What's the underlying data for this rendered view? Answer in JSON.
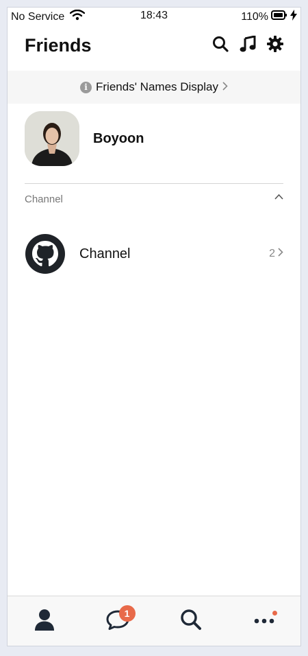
{
  "status_bar": {
    "carrier": "No Service",
    "time": "18:43",
    "battery": "110%"
  },
  "header": {
    "title": "Friends"
  },
  "banner": {
    "text": "Friends' Names Display"
  },
  "profile": {
    "name": "Boyoon"
  },
  "section": {
    "label": "Channel"
  },
  "channel": {
    "label": "Channel",
    "count": "2"
  },
  "tabbar": {
    "chat_badge": "1"
  },
  "colors": {
    "badge": "#e86a4a",
    "banner_bg": "#f6f6f6",
    "page_bg": "#e8ebf3"
  },
  "icons": [
    "wifi-icon",
    "battery-icon",
    "charging-icon",
    "search-icon",
    "music-icon",
    "gear-icon",
    "info-icon",
    "chevron-right-icon",
    "chevron-up-icon",
    "github-icon",
    "person-icon",
    "chat-icon",
    "more-icon"
  ]
}
